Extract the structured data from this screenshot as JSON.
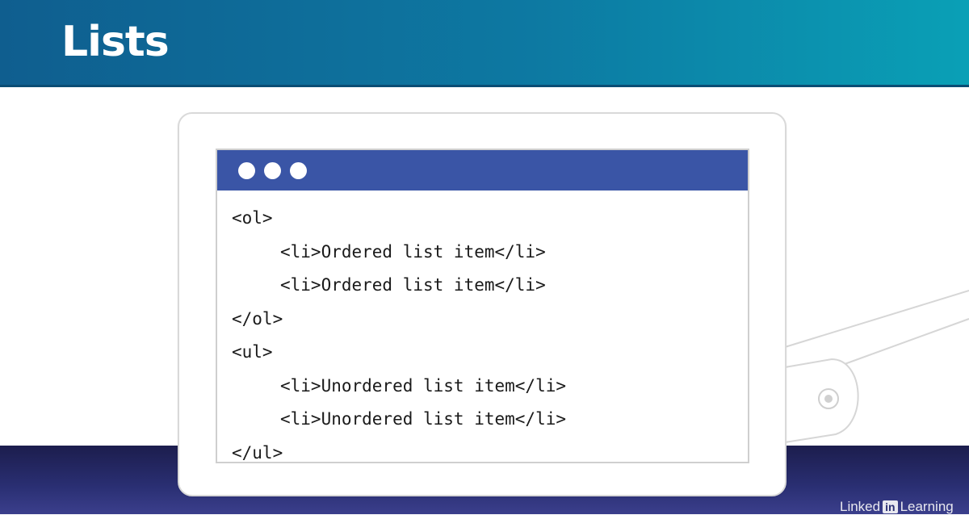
{
  "slide": {
    "title": "Lists"
  },
  "window": {
    "control_dots": [
      "dot",
      "dot",
      "dot"
    ]
  },
  "code": {
    "lines": [
      {
        "text": "<ol>",
        "indent": 0
      },
      {
        "text": "<li>Ordered list item</li>",
        "indent": 1
      },
      {
        "text": "<li>Ordered list item</li>",
        "indent": 1
      },
      {
        "text": "</ol>",
        "indent": 0
      },
      {
        "text": "<ul>",
        "indent": 0
      },
      {
        "text": "<li>Unordered list item</li>",
        "indent": 1
      },
      {
        "text": "<li>Unordered list item</li>",
        "indent": 1
      },
      {
        "text": "</ul>",
        "indent": 0
      }
    ]
  },
  "branding": {
    "word_before": "Linked",
    "badge": "in",
    "word_after": "Learning"
  },
  "colors": {
    "header_start": "#0f5e8f",
    "header_end": "#0aa0b6",
    "titlebar": "#3a55a6",
    "bottom_band": "#1c1d4d"
  }
}
